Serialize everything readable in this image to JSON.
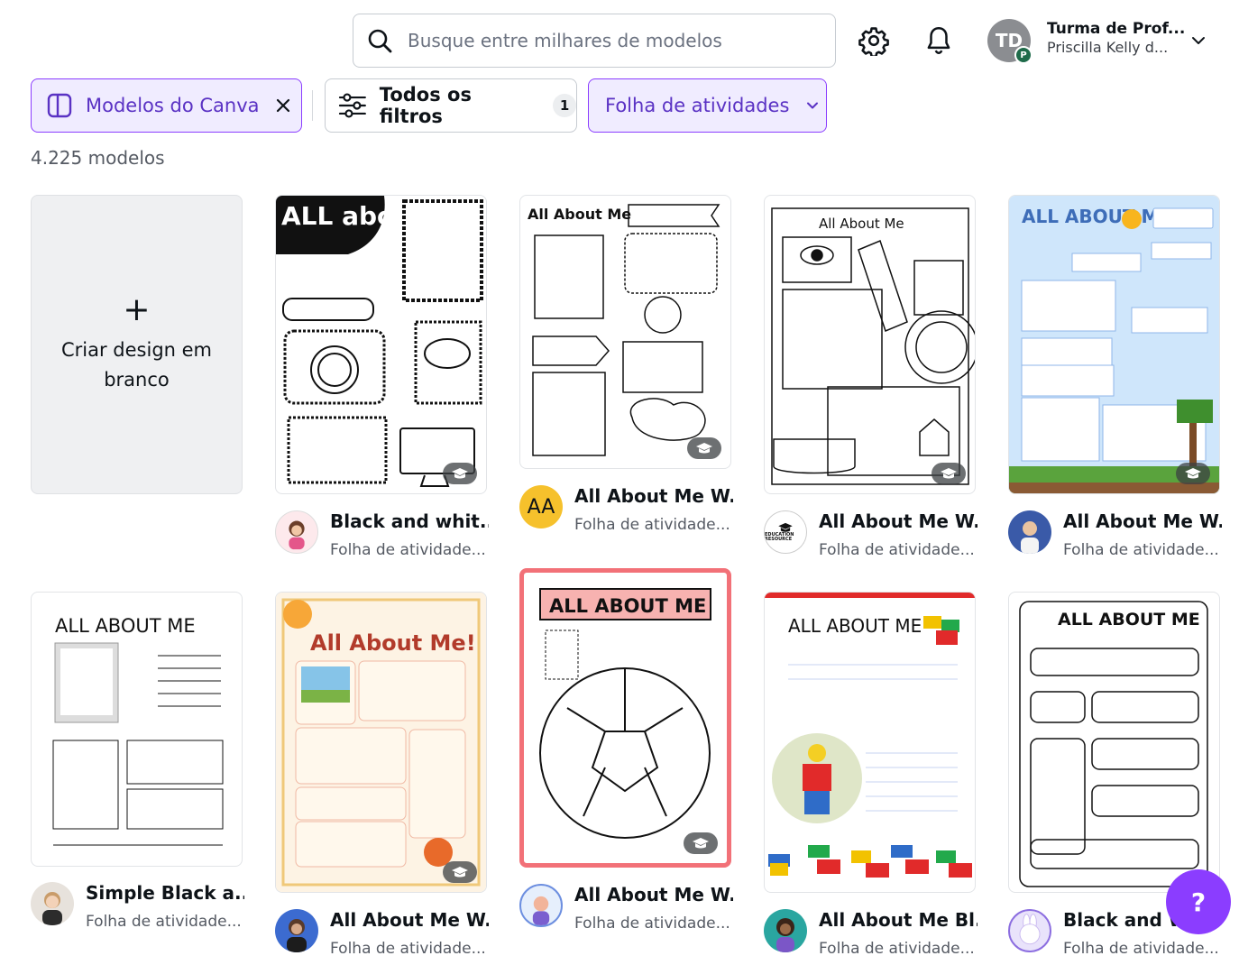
{
  "search": {
    "placeholder": "Busque entre milhares de modelos"
  },
  "header": {
    "account_initials": "TD",
    "account_badge": "P",
    "account_name": "Turma de Prof...",
    "account_sub": "Priscilla Kelly d..."
  },
  "filters": {
    "canva_models": "Modelos do Canva",
    "all_filters": "Todos os filtros",
    "all_filters_count": "1",
    "category": "Folha de atividades"
  },
  "results_count": "4.225 modelos",
  "blank_card": {
    "label": "Criar design em branco"
  },
  "templates": [
    {
      "title": "Black and whit...",
      "subtitle": "Folha de atividade...",
      "thumb_heading": "ALL about ME!"
    },
    {
      "title": "All About Me W...",
      "subtitle": "Folha de atividade...",
      "author_initials": "AA",
      "thumb_heading": "All About Me"
    },
    {
      "title": "All About Me W...",
      "subtitle": "Folha de atividade...",
      "thumb_heading": "All About Me",
      "author_label": "EDUCATION RESOURCE"
    },
    {
      "title": "All About Me W...",
      "subtitle": "Folha de atividade...",
      "thumb_heading": "ALL ABOUT ME"
    },
    {
      "title": "Simple Black a...",
      "subtitle": "Folha de atividade...",
      "thumb_heading": "ALL ABOUT ME"
    },
    {
      "title": "All About Me W...",
      "subtitle": "Folha de atividade...",
      "thumb_heading": "All About Me!"
    },
    {
      "title": "All About Me W...",
      "subtitle": "Folha de atividade...",
      "thumb_heading": "ALL ABOUT ME"
    },
    {
      "title": "All About Me Bl...",
      "subtitle": "Folha de atividade...",
      "thumb_heading": "ALL ABOUT ME"
    },
    {
      "title": "Black and Wh...",
      "subtitle": "Folha de atividade...",
      "thumb_heading": "ALL ABOUT ME"
    }
  ],
  "help_button": "?",
  "colors": {
    "accent": "#8b3dff",
    "chip_bg": "#f0ecff",
    "selected_border": "#f27178"
  },
  "icons": [
    "search-icon",
    "gear-icon",
    "bell-icon",
    "chevron-down-icon",
    "layout-icon",
    "close-icon",
    "filter-sliders-icon",
    "education-cap-icon",
    "plus-icon"
  ]
}
